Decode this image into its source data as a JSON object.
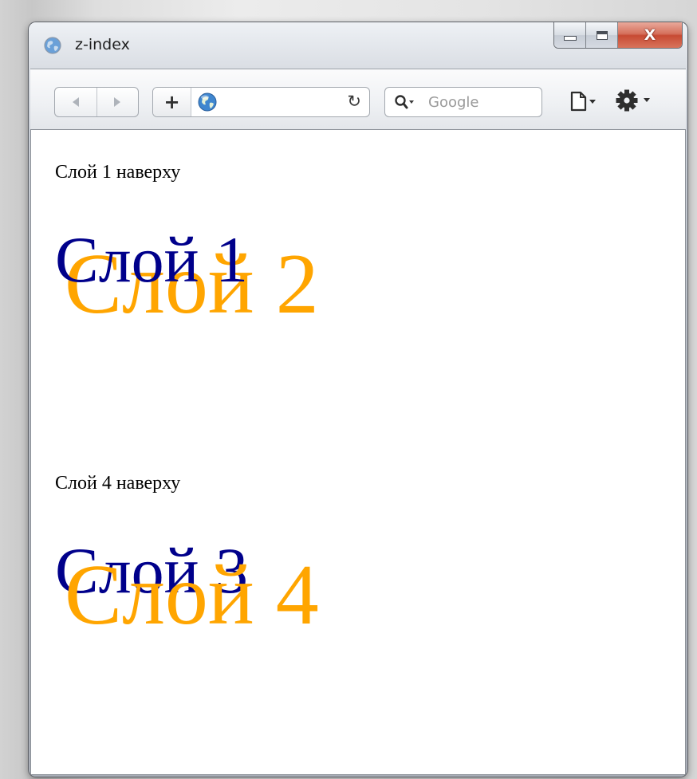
{
  "window": {
    "title": "z-index",
    "close_glyph": "X"
  },
  "toolbar": {
    "add_label": "+",
    "reload_glyph": "↻",
    "search_placeholder": "Google"
  },
  "content": {
    "section1": {
      "caption": "Слой 1 наверху",
      "layer_blue": "Слой 1",
      "layer_orange": "Слой 2"
    },
    "section2": {
      "caption": "Слой 4 наверху",
      "layer_blue": "Слой 3",
      "layer_orange": "Слой 4"
    }
  },
  "colors": {
    "blue_layer": "#00008b",
    "orange_layer": "#ffa500"
  },
  "icons": {
    "title": "globe-icon",
    "back": "back-arrow-icon",
    "forward": "forward-arrow-icon",
    "address": "globe-icon",
    "search": "search-icon",
    "page_menu": "page-icon",
    "settings_menu": "gear-icon"
  }
}
